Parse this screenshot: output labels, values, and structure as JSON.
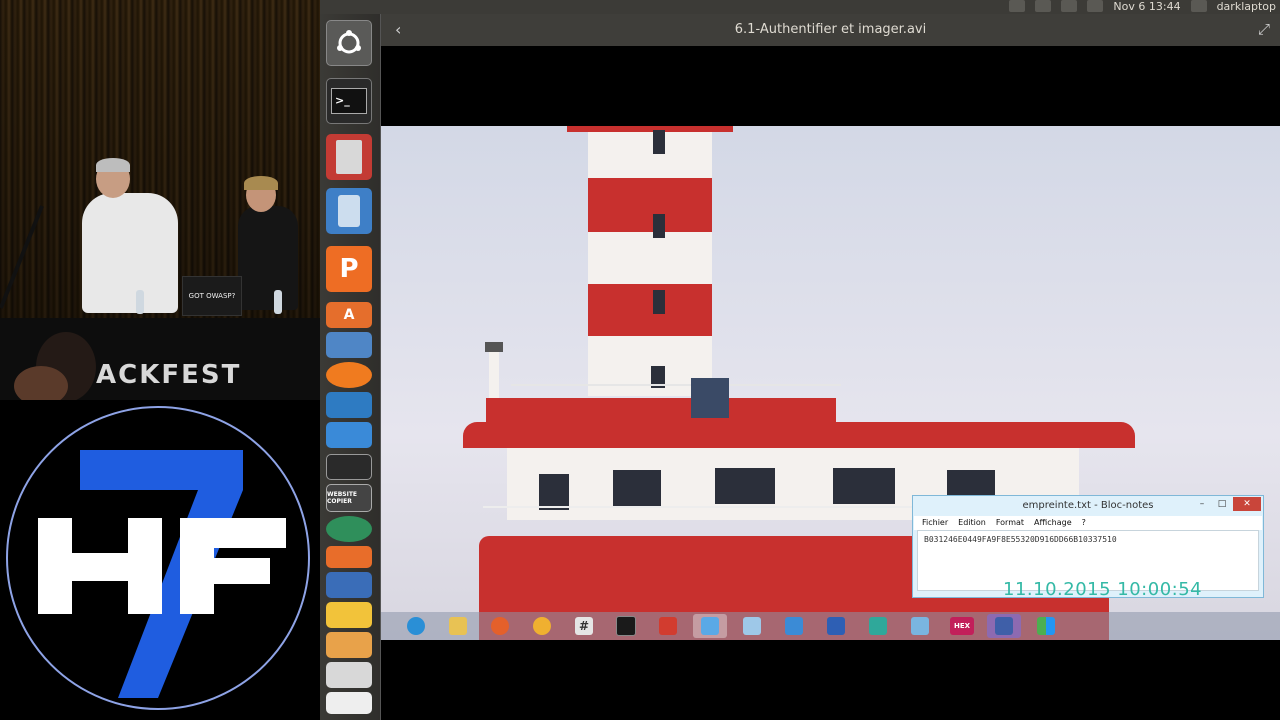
{
  "topbar": {
    "datetime": "Nov 6 13:44",
    "username": "darklaptop"
  },
  "stage": {
    "banner_text": "ACKFEST",
    "laptop_sticker": "GOT OWASP?"
  },
  "logo": {
    "letters": "HF",
    "number": "7",
    "colors": {
      "number": "#1f5de0",
      "letters": "#ffffff",
      "ring": "#8ea3e6"
    }
  },
  "launcher": {
    "items": [
      {
        "name": "dash-icon"
      },
      {
        "name": "terminal-icon"
      },
      {
        "name": "file-cabinet-icon"
      },
      {
        "name": "speaker-icon"
      },
      {
        "name": "p-app-icon"
      },
      {
        "name": "software-center-icon"
      },
      {
        "name": "stacked-app-icon"
      },
      {
        "name": "vlc-icon"
      },
      {
        "name": "document-viewer-icon"
      },
      {
        "name": "website-copier-icon",
        "label": "WEBSITE COPIER"
      },
      {
        "name": "globe-tool-icon"
      },
      {
        "name": "stack-tool-icon"
      },
      {
        "name": "mail-tool-icon"
      },
      {
        "name": "funnel-icon"
      },
      {
        "name": "notes-icon"
      },
      {
        "name": "bucket-icon"
      }
    ]
  },
  "video_window": {
    "title": "6.1-Authentifier et imager.avi"
  },
  "notepad": {
    "title": "empreinte.txt - Bloc-notes",
    "menu": [
      "Fichier",
      "Edition",
      "Format",
      "Affichage",
      "?"
    ],
    "content": "B031246E0449FA9F8E55320D916DD66B10337510",
    "buttons": {
      "minimize": "–",
      "maximize": "□",
      "close": "✕"
    }
  },
  "timestamp": "11.10.2015 10:00:54",
  "taskbar": {
    "items": [
      {
        "name": "ie-icon",
        "color": "#2a8fd6"
      },
      {
        "name": "explorer-icon",
        "color": "#e8c254"
      },
      {
        "name": "firefox-icon",
        "color": "#e4602b"
      },
      {
        "name": "compass-icon",
        "color": "#f0b030"
      },
      {
        "name": "hash-icon",
        "color": "#e5e5e5",
        "text": "#"
      },
      {
        "name": "cmd-icon",
        "color": "#1a1a1a"
      },
      {
        "name": "dc-icon",
        "color": "#d23c2f"
      },
      {
        "name": "window-icon",
        "color": "#5aa9e6"
      },
      {
        "name": "doc-icon",
        "color": "#9ec8e8"
      },
      {
        "name": "network-icon",
        "color": "#3b8bd6"
      },
      {
        "name": "user-tool-icon",
        "color": "#2e5fb4"
      },
      {
        "name": "grid-tool-icon",
        "color": "#2fa89a"
      },
      {
        "name": "folder-tool-icon",
        "color": "#7ab5e0"
      },
      {
        "name": "hex-workshop-icon",
        "color": "#c21f5a",
        "text": "HEX"
      },
      {
        "name": "camera-icon",
        "color": "#3f5fa8"
      },
      {
        "name": "tiles-icon",
        "color": "#4caf50"
      }
    ]
  }
}
